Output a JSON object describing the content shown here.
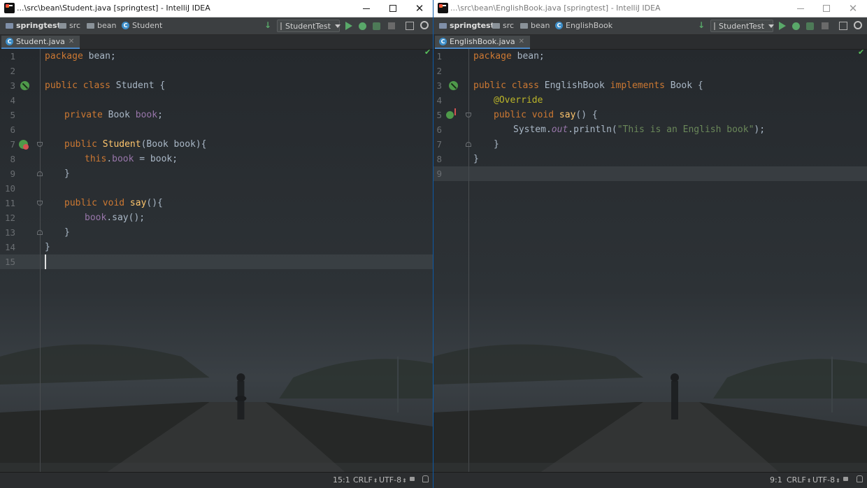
{
  "colors": {
    "keyword": "#cc7832",
    "field": "#9876aa",
    "method": "#ffc66d",
    "string": "#6a8759",
    "annotation": "#bbb529",
    "plain": "#a9b7c6",
    "run_green": "#59a869"
  },
  "left": {
    "title": "...\\src\\bean\\Student.java [springtest] - IntelliJ IDEA",
    "breadcrumb": {
      "project": "springtest",
      "src": "src",
      "pkg": "bean",
      "cls": "Student"
    },
    "run_config": "StudentTest",
    "tab": "Student.java",
    "code": {
      "l1": [
        "package",
        " bean;"
      ],
      "l3": [
        "public class",
        " Student {"
      ],
      "l5": [
        "private",
        " Book ",
        "book",
        ";"
      ],
      "l7": [
        "public",
        " ",
        "Student",
        "(Book book){"
      ],
      "l8": [
        "this",
        ".",
        "book",
        " = book;"
      ],
      "l9": "}",
      "l11": [
        "public void",
        " ",
        "say",
        "(){"
      ],
      "l12": [
        "book",
        ".say();"
      ],
      "l13": "}",
      "l14": "}"
    },
    "status": {
      "position": "15:1",
      "line_sep": "CRLF",
      "encoding": "UTF-8"
    }
  },
  "right": {
    "title": "...\\src\\bean\\EnglishBook.java [springtest] - IntelliJ IDEA",
    "breadcrumb": {
      "project": "springtest",
      "src": "src",
      "pkg": "bean",
      "cls": "EnglishBook"
    },
    "run_config": "StudentTest",
    "tab": "EnglishBook.java",
    "code": {
      "l1": [
        "package",
        " bean;"
      ],
      "l3": [
        "public class",
        " EnglishBook ",
        "implements",
        " Book {"
      ],
      "l4": "@Override",
      "l5": [
        "public void",
        " ",
        "say",
        "() {"
      ],
      "l6": [
        "System.",
        "out",
        ".println(",
        "\"This is an English book\"",
        ");"
      ],
      "l7": "}",
      "l8": "}"
    },
    "status": {
      "position": "9:1",
      "line_sep": "CRLF",
      "encoding": "UTF-8"
    }
  },
  "line_numbers_left": [
    "1",
    "2",
    "3",
    "4",
    "5",
    "6",
    "7",
    "8",
    "9",
    "10",
    "11",
    "12",
    "13",
    "14",
    "15"
  ],
  "line_numbers_right": [
    "1",
    "2",
    "3",
    "4",
    "5",
    "6",
    "7",
    "8",
    "9"
  ],
  "icons": {
    "app": "intellij-icon",
    "class_gutter": "class-icon",
    "constructor_gutter": "constructor-icon",
    "implements_gutter": "implements-method-icon",
    "check": "check-icon"
  }
}
